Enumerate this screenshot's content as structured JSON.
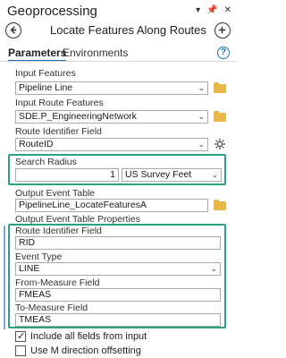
{
  "pane": {
    "title": "Geoprocessing"
  },
  "tool": {
    "title": "Locate Features Along Routes"
  },
  "tabs": {
    "parameters": "Parameters",
    "environments": "Environments"
  },
  "params": {
    "input_features": {
      "label": "Input Features",
      "value": "Pipeline Line"
    },
    "input_route_features": {
      "label": "Input Route Features",
      "value": "SDE.P_EngineeringNetwork"
    },
    "route_id_field": {
      "label": "Route Identifier Field",
      "value": "RouteID"
    },
    "search_radius": {
      "label": "Search Radius",
      "value": "1",
      "unit": "US Survey Feet"
    },
    "output_event_table": {
      "label": "Output Event Table",
      "value": "PipelineLine_LocateFeaturesA"
    },
    "output_event_props": {
      "label": "Output Event Table Properties"
    },
    "props_route_id": {
      "label": "Route Identifier Field",
      "value": "RID"
    },
    "event_type": {
      "label": "Event Type",
      "value": "LINE"
    },
    "from_measure": {
      "label": "From-Measure Field",
      "value": "FMEAS"
    },
    "to_measure": {
      "label": "To-Measure Field",
      "value": "TMEAS"
    },
    "include_all_fields": {
      "label": "Include all fields from input",
      "checked": true
    },
    "use_m_direction": {
      "label": "Use M direction offsetting",
      "checked": false
    }
  },
  "colors": {
    "highlight": "#2aa187",
    "accent": "#1a6fb5",
    "folder": "#e8b84a"
  },
  "icons": [
    "pin-icon",
    "close-icon",
    "back-icon",
    "add-icon",
    "help-icon",
    "folder-icon",
    "gear-icon",
    "chevron-down-icon"
  ]
}
